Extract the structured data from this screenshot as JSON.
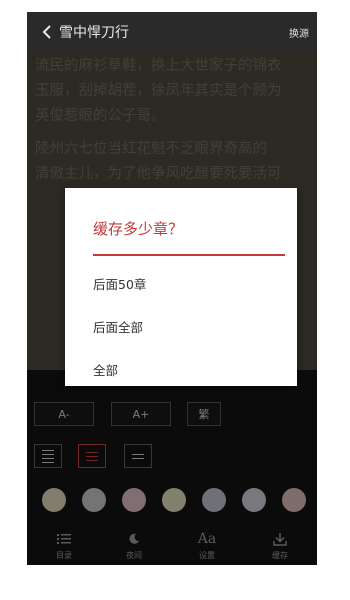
{
  "topbar": {
    "title": "雪中悍刀行",
    "source_label": "换源"
  },
  "reader": {
    "lines": [
      "流民的麻衫草鞋，换上大世家子的锦衣",
      "玉服，刮掉胡茬，徐凤年其实是个顾为",
      "英俊惹眼的公子哥。",
      "    陵州六七位当红花魁不乏眼界奇高的",
      "清傲主儿，为了他争风吃醋要死要活可"
    ]
  },
  "dialog": {
    "title": "缓存多少章？",
    "options": [
      "后面50章",
      "后面全部",
      "全部"
    ]
  },
  "settings": {
    "font_decrease": "A-",
    "font_increase": "A+",
    "traditional": "繁",
    "active_color": "#b13a3a",
    "swatch_colors": [
      "#c7c0a8",
      "#b3b3b3",
      "#c6a9b0",
      "#c7c6a8",
      "#a9b0b8",
      "#b9b9c4",
      "#c2a8a4"
    ]
  },
  "bottom_nav": [
    {
      "label": "目录",
      "icon": "list-icon"
    },
    {
      "label": "夜间",
      "icon": "moon-icon"
    },
    {
      "label": "设置",
      "icon": "font-icon"
    },
    {
      "label": "缓存",
      "icon": "download-icon"
    }
  ]
}
